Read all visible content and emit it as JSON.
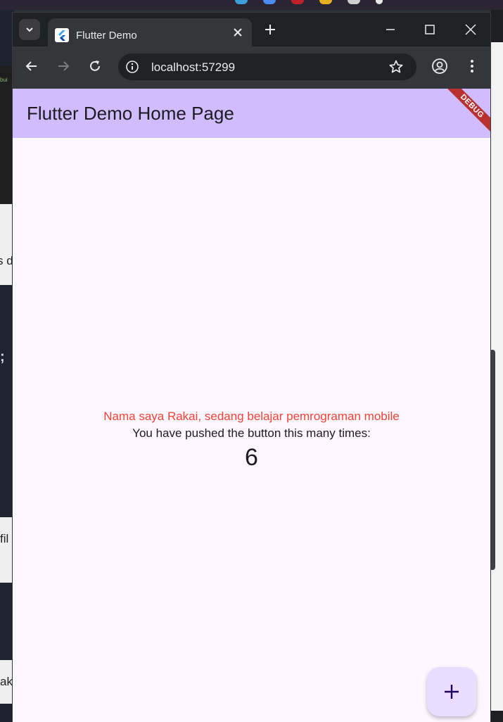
{
  "browser": {
    "tab": {
      "title": "Flutter Demo",
      "favicon": "flutter-logo-icon"
    },
    "url": "localhost:57299",
    "icons": {
      "tab_search": "chevron-down-icon",
      "tab_close": "close-icon",
      "new_tab": "plus-icon",
      "minimize": "minimize-icon",
      "maximize": "maximize-icon",
      "close_window": "close-icon",
      "back": "arrow-left-icon",
      "forward": "arrow-right-icon",
      "reload": "reload-icon",
      "site_info": "info-icon",
      "bookmark": "star-icon",
      "profile": "profile-icon",
      "menu": "kebab-menu-icon"
    }
  },
  "app": {
    "appbar_title": "Flutter Demo Home Page",
    "debug_banner": "DEBUG",
    "intro_text": "Nama saya Rakai, sedang belajar pemrograman mobile",
    "push_label": "You have pushed the button this many times:",
    "counter_value": "6",
    "fab_icon": "plus-icon"
  },
  "background": {
    "left_snippets": [
      "bui",
      "s de",
      ";",
      "fil",
      "ak"
    ]
  },
  "colors": {
    "appbar": "#d0bcff",
    "page_bg": "#fef7ff",
    "intro_text": "#f44336",
    "fab_bg": "#eaddff",
    "fab_icon": "#21005d",
    "debug_banner": "#b8312f"
  }
}
